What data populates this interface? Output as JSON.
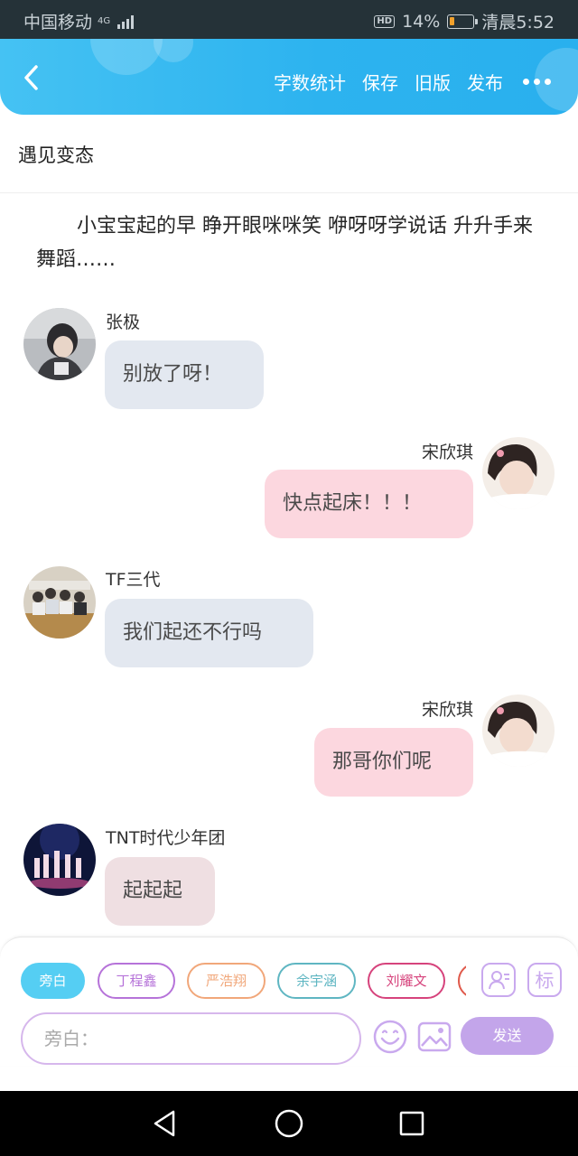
{
  "status_bar": {
    "carrier": "中国移动",
    "network": "4G",
    "hd": "HD",
    "battery_percent": "14%",
    "battery_level": 0.14,
    "time": "清晨5:52",
    "colors": {
      "background": "#253238",
      "battery_fill": "#f0a02b"
    }
  },
  "toolbar": {
    "back_icon": "chevron-left-icon",
    "word_count": "字数统计",
    "save": "保存",
    "old_version": "旧版",
    "publish": "发布",
    "more_icon": "more-dots-icon",
    "colors": {
      "gradient_start": "#45c2f3",
      "gradient_end": "#29b0ee"
    }
  },
  "document": {
    "title": "遇见变态",
    "intro": "小宝宝起的早 睁开眼咪咪笑 咿呀呀学说话 升升手来舞蹈……"
  },
  "messages": [
    {
      "speaker": "张极",
      "text": "别放了呀！",
      "side": "left"
    },
    {
      "speaker": "宋欣琪",
      "text": "快点起床！！！",
      "side": "right"
    },
    {
      "speaker": "TF三代",
      "text": "我们起还不行吗",
      "side": "left"
    },
    {
      "speaker": "宋欣琪",
      "text": "那哥你们呢",
      "side": "right"
    },
    {
      "speaker": "TNT时代少年团",
      "text": "起起起",
      "side": "left"
    }
  ],
  "composer": {
    "chips": [
      {
        "label": "旁白",
        "active": true,
        "color": "#55cef3"
      },
      {
        "label": "丁程鑫",
        "active": false,
        "color": "#b673d9"
      },
      {
        "label": "严浩翔",
        "active": false,
        "color": "#f1a77a"
      },
      {
        "label": "余宇涵",
        "active": false,
        "color": "#5fb6c2"
      },
      {
        "label": "刘耀文",
        "active": false,
        "color": "#d6437c"
      }
    ],
    "character_icon": "character-card-icon",
    "tag_label": "标",
    "input_placeholder": "旁白：",
    "emoji_icon": "emoji-icon",
    "image_icon": "image-icon",
    "send_label": "发送",
    "colors": {
      "accent": "#c3a5ea",
      "input_border": "#d6b7ec"
    }
  },
  "nav_bar": {
    "back_icon": "nav-back-icon",
    "home_icon": "nav-home-icon",
    "recents_icon": "nav-recents-icon"
  }
}
